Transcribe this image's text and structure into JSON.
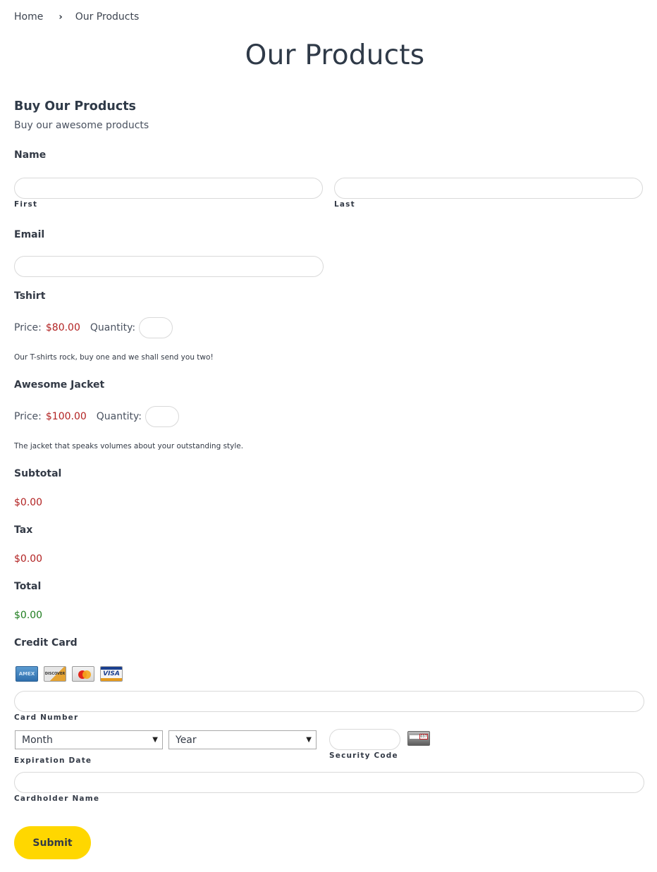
{
  "breadcrumb": {
    "home": "Home",
    "separator_icon": "chevron-right-icon",
    "separator_glyph": "›",
    "current": "Our Products"
  },
  "page": {
    "title": "Our Products"
  },
  "form": {
    "title": "Buy Our Products",
    "description": "Buy our awesome products",
    "name": {
      "label": "Name",
      "first": {
        "sublabel": "First",
        "value": "",
        "placeholder": ""
      },
      "last": {
        "sublabel": "Last",
        "value": "",
        "placeholder": ""
      }
    },
    "email": {
      "label": "Email",
      "value": "",
      "placeholder": ""
    },
    "products": [
      {
        "name": "Tshirt",
        "price_label": "Price:",
        "price": "$80.00",
        "quantity_label": "Quantity:",
        "quantity": "",
        "description": "Our T-shirts rock, buy one and we shall send you two!"
      },
      {
        "name": "Awesome Jacket",
        "price_label": "Price:",
        "price": "$100.00",
        "quantity_label": "Quantity:",
        "quantity": "",
        "description": "The jacket that speaks volumes about your outstanding style."
      }
    ],
    "subtotal": {
      "label": "Subtotal",
      "value": "$0.00"
    },
    "tax": {
      "label": "Tax",
      "value": "$0.00"
    },
    "total": {
      "label": "Total",
      "value": "$0.00"
    },
    "credit_card": {
      "label": "Credit Card",
      "card_types": [
        {
          "icon": "amex-icon",
          "text": "AMEX"
        },
        {
          "icon": "discover-icon",
          "text": "DISCOVER"
        },
        {
          "icon": "mastercard-icon",
          "text": ""
        },
        {
          "icon": "visa-icon",
          "text": "VISA"
        }
      ],
      "card_number": {
        "sublabel": "Card Number",
        "value": ""
      },
      "expiration": {
        "sublabel": "Expiration Date",
        "month": "Month",
        "year": "Year",
        "arrow_glyph": "▼"
      },
      "security_code": {
        "sublabel": "Security Code",
        "value": "",
        "cvv_sample": "037"
      },
      "cardholder_name": {
        "sublabel": "Cardholder Name",
        "value": ""
      }
    },
    "submit_label": "Submit"
  },
  "colors": {
    "price": "#b22222",
    "total": "#1e7d1e",
    "submit_bg": "#ffd700",
    "heading": "#2f3a48"
  }
}
